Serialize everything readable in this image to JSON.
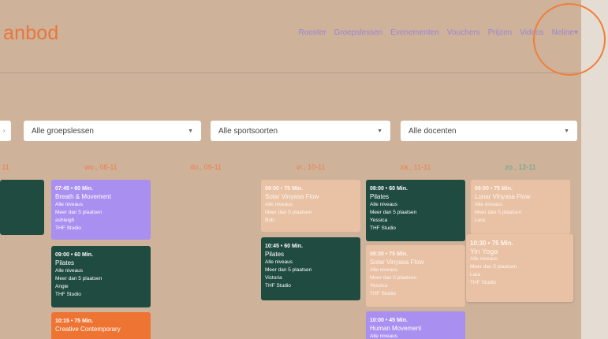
{
  "brand": "anbod",
  "nav": {
    "items": [
      "Rooster",
      "Groepslessen",
      "Evenementen",
      "Vouchers",
      "Prijzen",
      "Videos"
    ],
    "user": "Neline",
    "user_caret": "▾"
  },
  "filters": {
    "classes": "Alle groepslessen",
    "sports": "Alle sportsoorten",
    "teachers": "Alle docenten",
    "caret": "▼"
  },
  "days": [
    "11",
    "wo., 08-11",
    "do., 09-11",
    "vr., 10-11",
    "za., 11-11",
    "zo., 12-11"
  ],
  "sessions": [
    {
      "time": "07:45 • 60 Min.",
      "name": "Breath & Movement",
      "level": "Alle niveaus",
      "spots": "Meer dan 5 plaatsen",
      "teacher": "ashleigh",
      "studio": "THF Studio"
    },
    {
      "time": "09:00 • 60 Min.",
      "name": "Pilates",
      "level": "Alle niveaus",
      "spots": "Meer dan 5 plaatsen",
      "teacher": "Angie",
      "studio": "THF Studio"
    },
    {
      "time": "10:15 • 75 Min.",
      "name": "Creative Contemporary"
    },
    {
      "time": "09:00 • 75 Min.",
      "name": "Solar Vinyasa Flow",
      "level": "Alle niveaus",
      "spots": "Meer dan 5 plaatsen",
      "teacher": "Bob"
    },
    {
      "time": "10:45 • 60 Min.",
      "name": "Pilates",
      "level": "Alle niveaus",
      "spots": "Meer dan 5 plaatsen",
      "teacher": "Victoria",
      "studio": "THF Studio"
    },
    {
      "time": "08:00 • 60 Min.",
      "name": "Pilates",
      "level": "Alle niveaus",
      "spots": "Meer dan 5 plaatsen",
      "teacher": "Yessica",
      "studio": "THF Studio"
    },
    {
      "time": "09:30 • 75 Min.",
      "name": "Solar Vinyasa Flow",
      "level": "Alle niveaus",
      "spots": "Meer dan 5 plaatsen",
      "teacher": "Yessica",
      "studio": "THF Studio"
    },
    {
      "time": "10:00 • 45 Min.",
      "name": "Human Movement",
      "level": "Alle niveaus"
    },
    {
      "time": "09:00 • 75 Min.",
      "name": "Lunar Vinyasa Flow",
      "level": "Alle niveaus",
      "spots": "Meer dan 5 plaatsen",
      "teacher": "Lara"
    },
    {
      "time": "10:30 • 75 Min.",
      "name": "Yin Yoga",
      "level": "Alle niveaus",
      "spots": "Meer dan 5 plaatsen",
      "teacher": "Lara",
      "studio": "THF Studio"
    }
  ],
  "colors": {
    "app_bg": "#cfb29a",
    "brand": "#e8773c",
    "nav_link": "#9a86d6",
    "card_dark": "#1f4b40",
    "card_purple": "#a98ff0",
    "card_peach": "#e9c2a6",
    "card_orange": "#ee7433",
    "highlight_ring": "#ef7f3a"
  }
}
